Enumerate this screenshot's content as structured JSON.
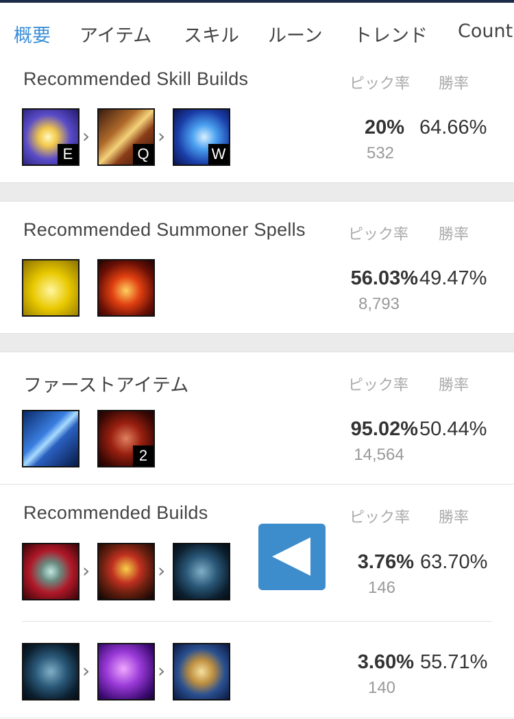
{
  "tabs": [
    {
      "label": "概要"
    },
    {
      "label": "アイテム"
    },
    {
      "label": "スキル"
    },
    {
      "label": "ルーン"
    },
    {
      "label": "トレンド"
    },
    {
      "label": "Count"
    }
  ],
  "headers": {
    "pick": "ピック率",
    "win": "勝率"
  },
  "skill_builds": {
    "title": "Recommended Skill Builds",
    "badges": [
      "E",
      "Q",
      "W"
    ],
    "pick": "20%",
    "win": "64.66%",
    "count": "532"
  },
  "summoner_spells": {
    "title": "Recommended Summoner Spells",
    "pick": "56.03%",
    "win": "49.47%",
    "count": "8,793"
  },
  "first_item": {
    "title": "ファーストアイテム",
    "badge": "2",
    "pick": "95.02%",
    "win": "50.44%",
    "count": "14,564"
  },
  "builds": {
    "title": "Recommended Builds",
    "rows": [
      {
        "pick": "3.76%",
        "win": "63.70%",
        "count": "146"
      },
      {
        "pick": "3.60%",
        "win": "55.71%",
        "count": "140"
      }
    ]
  },
  "icons": {
    "chevron": "›",
    "back_button": "left-triangle-icon"
  },
  "colors": {
    "accent": "#3b8fd9",
    "overlay_button": "#3d8ccc"
  }
}
